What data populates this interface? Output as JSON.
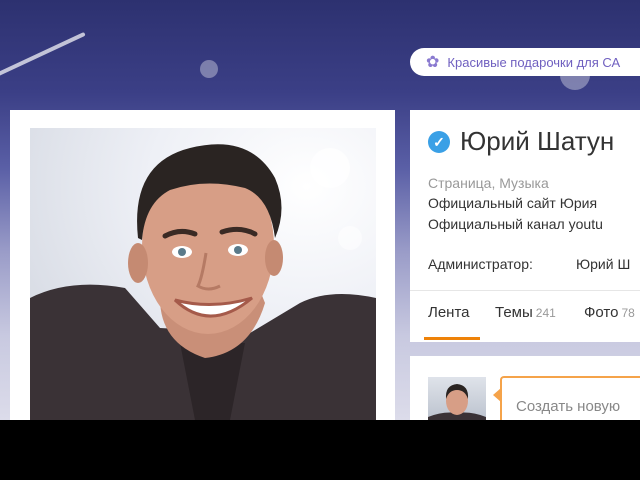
{
  "banner": {
    "gift_icon": "gear-icon",
    "text": "Красивые подарочки для СА"
  },
  "profile": {
    "verified_icon": "check-icon",
    "title": "Юрий Шатун",
    "category": "Страница, Музыка",
    "description_line1": "Официальный сайт Юрия",
    "description_line2": "Официальный канал youtu",
    "admin_label": "Администратор:",
    "admin_name": "Юрий Ш"
  },
  "tabs": [
    {
      "label": "Лента",
      "count": ""
    },
    {
      "label": "Темы",
      "count": "241"
    },
    {
      "label": "Фото",
      "count": "78"
    }
  ],
  "composer": {
    "placeholder": "Создать новую"
  },
  "colors": {
    "accent": "#ee8208",
    "verified": "#3aa0e6",
    "banner_text": "#7060c0"
  }
}
